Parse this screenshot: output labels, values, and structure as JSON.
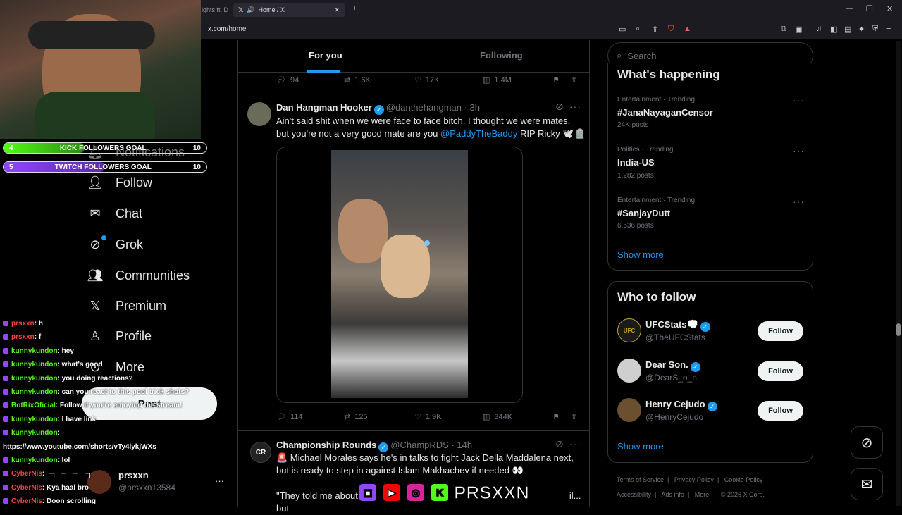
{
  "browser": {
    "inactive_tab": "ights ft. D",
    "active_tab": "Home / X",
    "url": "x.com/home"
  },
  "nav": {
    "notifications": "Notifications",
    "follow": "Follow",
    "chat": "Chat",
    "grok": "Grok",
    "communities": "Communities",
    "premium": "Premium",
    "profile": "Profile",
    "more": "More",
    "post": "Post",
    "account_name": "prsxxn",
    "account_handle": "@prsxxn13584"
  },
  "feed": {
    "tab_for_you": "For you",
    "tab_following": "Following",
    "top_actions": {
      "replies": "94",
      "reposts": "1.6K",
      "likes": "17K",
      "views": "1.4M"
    },
    "tweet1": {
      "name": "Dan Hangman Hooker",
      "handle": "@danthehangman",
      "time": "· 3h",
      "text_1": "Ain't said shit when we were face to face bitch. I thought we were mates,",
      "text_2": "but you're not a very good mate are you ",
      "mention": "@PaddyTheBaddy",
      "text_3": " RIP Ricky 🕊️🪦",
      "actions": {
        "replies": "114",
        "reposts": "125",
        "likes": "1.9K",
        "views": "344K"
      }
    },
    "tweet2": {
      "name": "Championship Rounds",
      "handle": "@ChampRDS",
      "time": "· 14h",
      "text_1": "🚨 Michael Morales says he's in talks to fight Jack Della Maddalena next,",
      "text_2": "but is ready to step in against Islam Makhachev if needed 👀",
      "text_3": "\"They told me about",
      "text_4": "il... but"
    }
  },
  "sidebar": {
    "search_placeholder": "Search",
    "whats_happening": "What's happening",
    "trends": [
      {
        "category": "Entertainment · Trending",
        "name": "#JanaNayaganCensor",
        "count": "24K posts"
      },
      {
        "category": "Politics · Trending",
        "name": "India-US",
        "count": "1,282 posts"
      },
      {
        "category": "Entertainment · Trending",
        "name": "#SanjayDutt",
        "count": "6,536 posts"
      }
    ],
    "show_more": "Show more",
    "who_to_follow": "Who to follow",
    "suggestions": [
      {
        "name": "UFCStats💭",
        "handle": "@TheUFCStats",
        "button": "Follow"
      },
      {
        "name": "Dear Son.",
        "handle": "@DearS_o_n",
        "button": "Follow"
      },
      {
        "name": "Henry Cejudo",
        "handle": "@HenryCejudo",
        "button": "Follow"
      }
    ],
    "show_more_2": "Show more",
    "footer_1": [
      "Terms of Service",
      "|",
      "Privacy Policy",
      "|",
      "Cookie Policy",
      "|"
    ],
    "footer_2": [
      "Accessibility",
      "|",
      "Ads info",
      "|",
      "More ···",
      "© 2026 X Corp."
    ]
  },
  "overlay": {
    "kick_goal": {
      "current": "4",
      "label": "KICK FOLLOWERS GOAL",
      "target": "10",
      "progress": 0.4
    },
    "twitch_goal": {
      "current": "5",
      "label": "TWITCH FOLLOWERS GOAL",
      "target": "10",
      "progress": 0.5
    },
    "chat": [
      {
        "user": "prsxxn",
        "msg": ": h",
        "color": "red"
      },
      {
        "user": "prsxxn",
        "msg": ": f",
        "color": "red"
      },
      {
        "user": "kunnykundon",
        "msg": ": hey",
        "color": "green"
      },
      {
        "user": "kunnykundon",
        "msg": ": what's good",
        "color": "green"
      },
      {
        "user": "kunnykundon",
        "msg": ": you doing reactions?",
        "color": "green"
      },
      {
        "user": "kunnykundon",
        "msg": ": can you react to this pool trick shots?",
        "color": "green"
      },
      {
        "user": "BotRixOficial",
        "msg": ": Follow if you're enjoying the stream!",
        "color": "green"
      },
      {
        "user": "kunnykundon",
        "msg": ": I have link",
        "color": "green"
      },
      {
        "user": "kunnykundon",
        "msg": ":",
        "color": "green"
      },
      {
        "user": "",
        "msg": "https://www.youtube.com/shorts/vTy4lykjWXs",
        "color": "white"
      },
      {
        "user": "kunnykundon",
        "msg": ": lol",
        "color": "green"
      },
      {
        "user": "CyberNis",
        "msg": ": ┌┐ ┌┐ ┌┐ ┌┐",
        "color": "red"
      },
      {
        "user": "CyberNis",
        "msg": ": Kya haal bro",
        "color": "red"
      },
      {
        "user": "CyberNis",
        "msg": ": Doon scrolling",
        "color": "red"
      }
    ],
    "banner_name": "PRSXXN"
  },
  "colors": {
    "accent": "#1d9bf0",
    "kick": "#53fc18",
    "twitch": "#9146ff",
    "background": "#000000"
  }
}
